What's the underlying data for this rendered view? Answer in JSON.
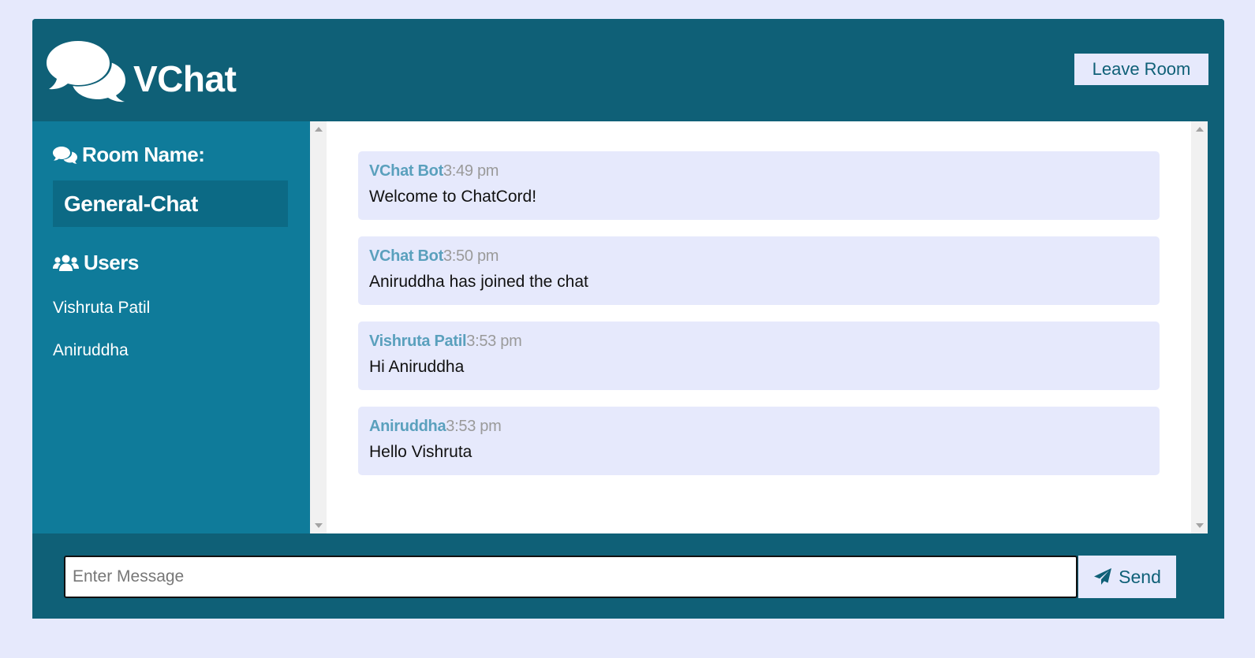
{
  "header": {
    "app_name": "VChat",
    "logo_icon": "comments-icon",
    "leave_label": "Leave Room"
  },
  "sidebar": {
    "room_title": "Room Name:",
    "room_name": "General-Chat",
    "users_title": "Users",
    "users": [
      "Vishruta Patil",
      "Aniruddha"
    ]
  },
  "messages": [
    {
      "author": "VChat Bot",
      "time": "3:49 pm",
      "text": "Welcome to ChatCord!"
    },
    {
      "author": "VChat Bot",
      "time": "3:50 pm",
      "text": "Aniruddha has joined the chat"
    },
    {
      "author": "Vishruta Patil",
      "time": "3:53 pm",
      "text": "Hi Aniruddha"
    },
    {
      "author": "Aniruddha",
      "time": "3:53 pm",
      "text": "Hello Vishruta"
    }
  ],
  "composer": {
    "placeholder": "Enter Message",
    "value": "",
    "send_label": "Send",
    "send_icon": "paper-plane-icon"
  },
  "colors": {
    "page_bg": "#e6e9fc",
    "header_bg": "#0f6077",
    "sidebar_bg": "#0f7b9a",
    "room_box_bg": "#0c6a85",
    "message_bg": "#e6e9fc",
    "author_color": "#5aa0bd",
    "time_color": "#9a9a9a"
  }
}
